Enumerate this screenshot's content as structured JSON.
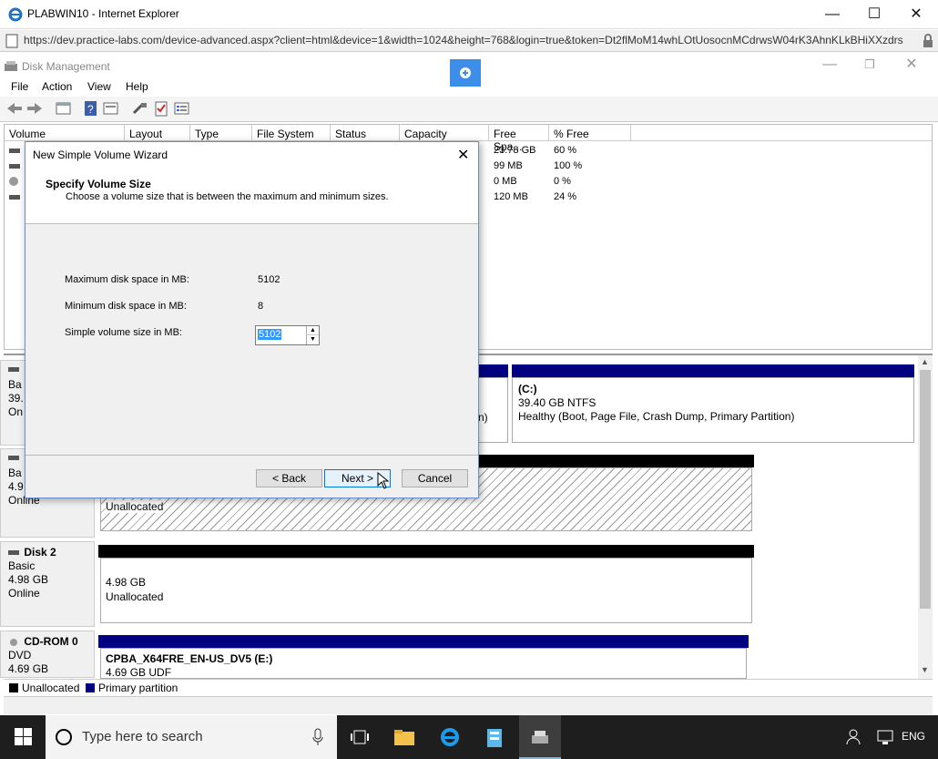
{
  "ie": {
    "title": "PLABWIN10 - Internet Explorer",
    "url": "https://dev.practice-labs.com/device-advanced.aspx?client=html&device=1&width=1024&height=768&login=true&token=Dt2flMoM14whLOtUosocnMCdrwsW04rK3AhnKLkBHiXXzdrs"
  },
  "dm": {
    "title": "Disk Management",
    "menu": [
      "File",
      "Action",
      "View",
      "Help"
    ],
    "columns": [
      "Volume",
      "Layout",
      "Type",
      "File System",
      "Status",
      "Capacity",
      "Free Spa...",
      "% Free"
    ],
    "rows": [
      {
        "free": "23.78 GB",
        "pct": "60 %"
      },
      {
        "free": "99 MB",
        "pct": "100 %"
      },
      {
        "free": "0 MB",
        "pct": "0 %"
      },
      {
        "free": "120 MB",
        "pct": "24 %"
      }
    ],
    "disks": {
      "disk0": {
        "l1": "Ba",
        "l2": "39.",
        "l3": "On",
        "c_name": "(C:)",
        "c_size": "39.40 GB NTFS",
        "c_status": "Healthy (Boot, Page File, Crash Dump, Primary Partition)",
        "frag": "n)"
      },
      "disk1": {
        "l1": "Ba",
        "l2": "4.9",
        "l3": "Online",
        "unalloc": "Unallocated"
      },
      "disk2": {
        "name": "Disk 2",
        "type": "Basic",
        "size": "4.98 GB",
        "status": "Online",
        "part_size": "4.98 GB",
        "part_label": "Unallocated"
      },
      "cdrom": {
        "name": "CD-ROM 0",
        "type": "DVD",
        "size": "4.69 GB",
        "part_name": "CPBA_X64FRE_EN-US_DV5 (E:)",
        "part_size": "4.69 GB UDF"
      }
    },
    "legend": {
      "unallocated": "Unallocated",
      "primary": "Primary partition"
    }
  },
  "wizard": {
    "title": "New Simple Volume Wizard",
    "heading": "Specify Volume Size",
    "subheading": "Choose a volume size that is between the maximum and minimum sizes.",
    "max_label": "Maximum disk space in MB:",
    "max_value": "5102",
    "min_label": "Minimum disk space in MB:",
    "min_value": "8",
    "size_label": "Simple volume size in MB:",
    "size_value": "5102",
    "back": "< Back",
    "next": "Next >",
    "cancel": "Cancel"
  },
  "taskbar": {
    "search_placeholder": "Type here to search",
    "lang": "ENG"
  }
}
